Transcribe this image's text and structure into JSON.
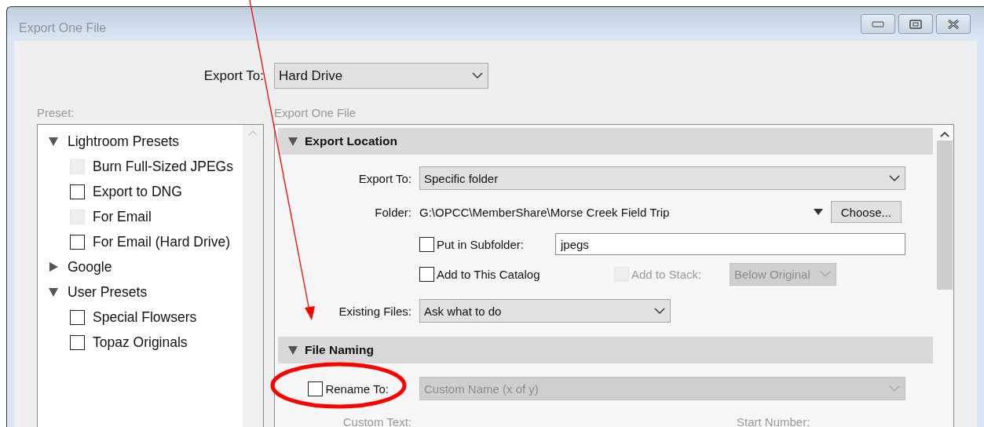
{
  "window": {
    "title": "Export One File"
  },
  "export_to": {
    "label": "Export To:",
    "value": "Hard Drive"
  },
  "preset": {
    "label": "Preset:",
    "tree": [
      {
        "label": "Lightroom Presets",
        "expanded": true,
        "children": [
          {
            "label": "Burn Full-Sized JPEGs",
            "checked": false,
            "disabled": true
          },
          {
            "label": "Export to DNG",
            "checked": false,
            "disabled": false
          },
          {
            "label": "For Email",
            "checked": false,
            "disabled": true
          },
          {
            "label": "For Email (Hard Drive)",
            "checked": false,
            "disabled": false
          }
        ]
      },
      {
        "label": "Google",
        "expanded": false
      },
      {
        "label": "User Presets",
        "expanded": true,
        "children": [
          {
            "label": "Special Flowsers",
            "checked": false,
            "disabled": false
          },
          {
            "label": "Topaz Originals",
            "checked": false,
            "disabled": false
          }
        ]
      }
    ]
  },
  "panel": {
    "label": "Export One File",
    "sections": [
      {
        "title": "Export Location",
        "expanded": true,
        "rows": [
          {
            "kind": "select",
            "label": "Export To:",
            "value": "Specific folder",
            "disabled": false
          },
          {
            "kind": "folder",
            "label": "Folder:",
            "value": "G:\\OPCC\\MemberShare\\Morse Creek Field Trip",
            "button": "Choose..."
          },
          {
            "kind": "checkbox_field",
            "checkbox": {
              "label": "Put in Subfolder:",
              "checked": false
            },
            "value": "jpegs"
          },
          {
            "kind": "checkbox_pair",
            "checkbox": {
              "label": "Add to This Catalog",
              "checked": false
            },
            "second": {
              "label": "Add to Stack:",
              "checked": false,
              "disabled": true
            },
            "select": {
              "value": "Below Original",
              "disabled": true
            }
          },
          {
            "kind": "short_select",
            "label": "Existing Files:",
            "value": "Ask what to do",
            "disabled": false
          }
        ]
      },
      {
        "title": "File Naming",
        "expanded": true,
        "rows": [
          {
            "kind": "checkbox_select",
            "checkbox": {
              "label": "Rename To:",
              "checked": false
            },
            "select": {
              "value": "Custom Name (x of y)",
              "disabled": true
            }
          },
          {
            "kind": "label_pair",
            "labels": [
              "Custom Text:",
              "Start Number:"
            ],
            "disabled": true
          }
        ]
      }
    ]
  },
  "annotations": {
    "arrow": true,
    "ellipse": true
  }
}
